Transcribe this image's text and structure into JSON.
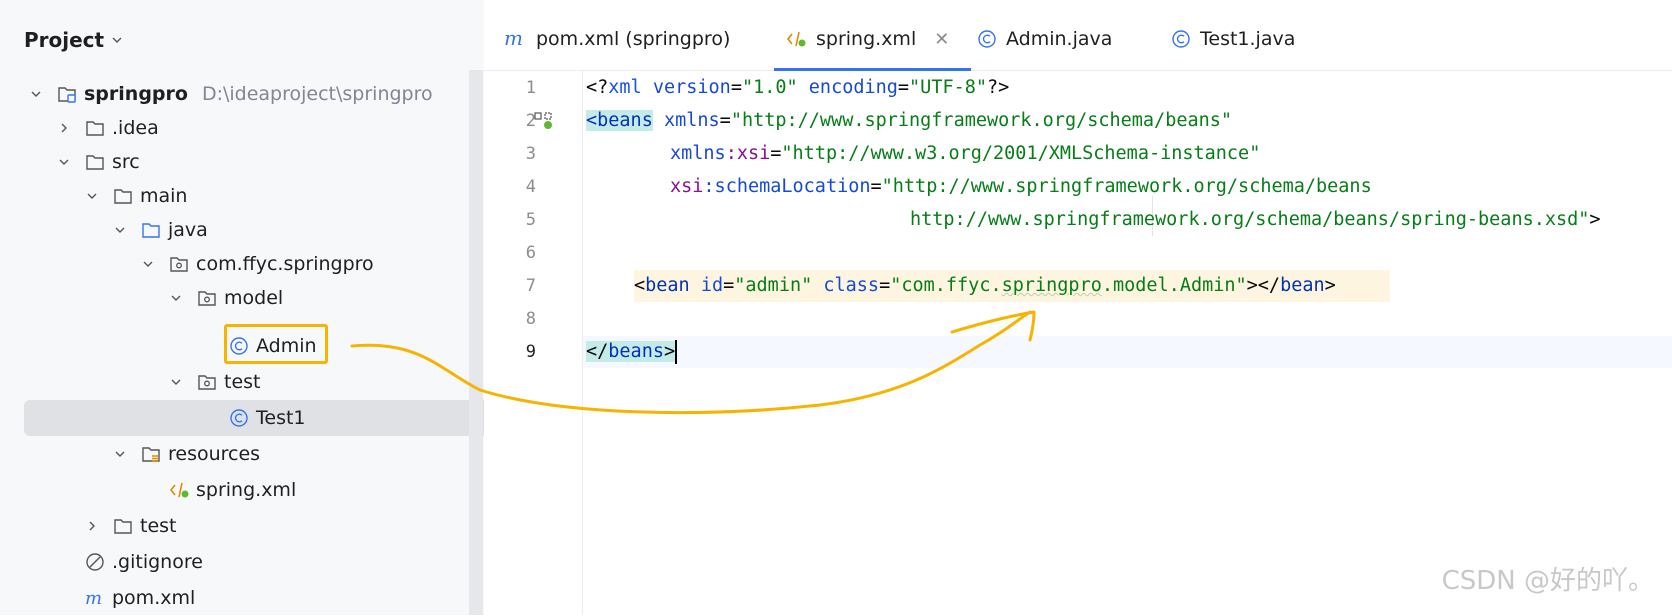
{
  "project": {
    "title": "Project",
    "tree": [
      {
        "label": "springpro",
        "path": "D:\\ideaproject\\springpro"
      },
      {
        "label": ".idea"
      },
      {
        "label": "src"
      },
      {
        "label": "main"
      },
      {
        "label": "java"
      },
      {
        "label": "com.ffyc.springpro"
      },
      {
        "label": "model"
      },
      {
        "label": "Admin"
      },
      {
        "label": "test"
      },
      {
        "label": "Test1"
      },
      {
        "label": "resources"
      },
      {
        "label": "spring.xml"
      },
      {
        "label": "test"
      },
      {
        "label": ".gitignore"
      },
      {
        "label": "pom.xml"
      }
    ]
  },
  "tabs": [
    {
      "label": "pom.xml (springpro)",
      "icon": "maven-icon"
    },
    {
      "label": "spring.xml",
      "icon": "spring-xml-icon",
      "active": true
    },
    {
      "label": "Admin.java",
      "icon": "class-icon"
    },
    {
      "label": "Test1.java",
      "icon": "class-icon"
    }
  ],
  "editor": {
    "line_numbers": [
      "1",
      "2",
      "3",
      "4",
      "5",
      "6",
      "7",
      "8",
      "9"
    ],
    "lines": {
      "l1": {
        "p1": "<?",
        "p2": "xml ",
        "p3": "version",
        "p4": "=",
        "p5": "\"1.0\"",
        "p6": " ",
        "p7": "encoding",
        "p8": "=",
        "p9": "\"UTF-8\"",
        "p10": "?>"
      },
      "l2": {
        "p1": "<beans",
        "p2": " ",
        "p3": "xmlns",
        "p4": "=",
        "p5": "\"http://www.springframework.org/schema/beans\""
      },
      "l3": {
        "p1": "xmlns",
        "p2": ":xsi",
        "p3": "=",
        "p4": "\"http://www.w3.org/2001/XMLSchema-instance\""
      },
      "l4": {
        "p1": "xsi",
        "p2": ":schemaLocation",
        "p3": "=",
        "p4": "\"http://www.springframework.org/schema/beans"
      },
      "l5": {
        "p1": "http://www.springframework.org/schema/beans/spring-beans.xsd\"",
        "p2": ">"
      },
      "l7": {
        "p1": "<",
        "p2": "bean",
        "p3": " ",
        "p4": "id",
        "p5": "=",
        "p6": "\"admin\"",
        "p7": " ",
        "p8": "class",
        "p9": "=",
        "p10": "\"com.ffyc.",
        "p11": "springpro",
        "p12": ".model.Admin\"",
        "p13": "></",
        "p14": "bean",
        "p15": ">"
      },
      "l9": {
        "p1": "</",
        "p2": "beans",
        "p3": ">"
      }
    }
  },
  "watermark": "CSDN @好的吖。",
  "colors": {
    "highlight_box": "#f6b400",
    "tab_underline": "#3574f0"
  }
}
